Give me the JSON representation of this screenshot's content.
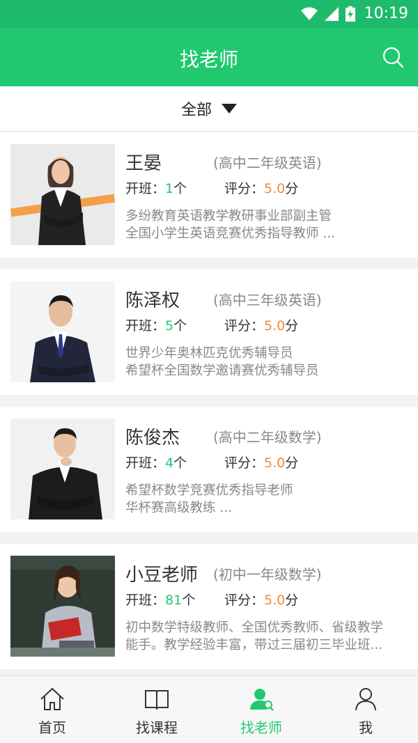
{
  "status_bar": {
    "time": "10:19",
    "icons": [
      "wifi-icon",
      "signal-icon",
      "battery-charging-icon"
    ]
  },
  "header": {
    "title": "找老师",
    "search_icon": "search-icon"
  },
  "filter": {
    "label": "全部"
  },
  "labels": {
    "classes_prefix": "开班：",
    "classes_suffix": "个",
    "rating_prefix": "评分：",
    "rating_suffix": "分"
  },
  "teachers": [
    {
      "name": "王晏",
      "grade": "(高中二年级英语)",
      "classes": "1",
      "rating": "5.0",
      "desc": [
        "多纷教育英语教学教研事业部副主管",
        "全国小学生英语竞赛优秀指导教师 ..."
      ]
    },
    {
      "name": "陈泽权",
      "grade": "(高中三年级英语)",
      "classes": "5",
      "rating": "5.0",
      "desc": [
        "世界少年奥林匹克优秀辅导员",
        "希望杯全国数学邀请赛优秀辅导员"
      ]
    },
    {
      "name": "陈俊杰",
      "grade": "(高中二年级数学)",
      "classes": "4",
      "rating": "5.0",
      "desc": [
        "希望杯数学竞赛优秀指导老师",
        "华杯赛高级教练 ..."
      ]
    },
    {
      "name": "小豆老师",
      "grade": "(初中一年级数学)",
      "classes": "81",
      "rating": "5.0",
      "desc": [
        "初中数学特级教师、全国优秀教师、省级教学",
        "能手。教学经验丰富，带过三届初三毕业班..."
      ]
    }
  ],
  "bottom_nav": [
    {
      "label": "首页",
      "icon": "home-icon",
      "active": false
    },
    {
      "label": "找课程",
      "icon": "book-icon",
      "active": false
    },
    {
      "label": "找老师",
      "icon": "teacher-icon",
      "active": true
    },
    {
      "label": "我",
      "icon": "user-icon",
      "active": false
    }
  ],
  "colors": {
    "primary": "#22c86f",
    "rating": "#f08b3a"
  }
}
